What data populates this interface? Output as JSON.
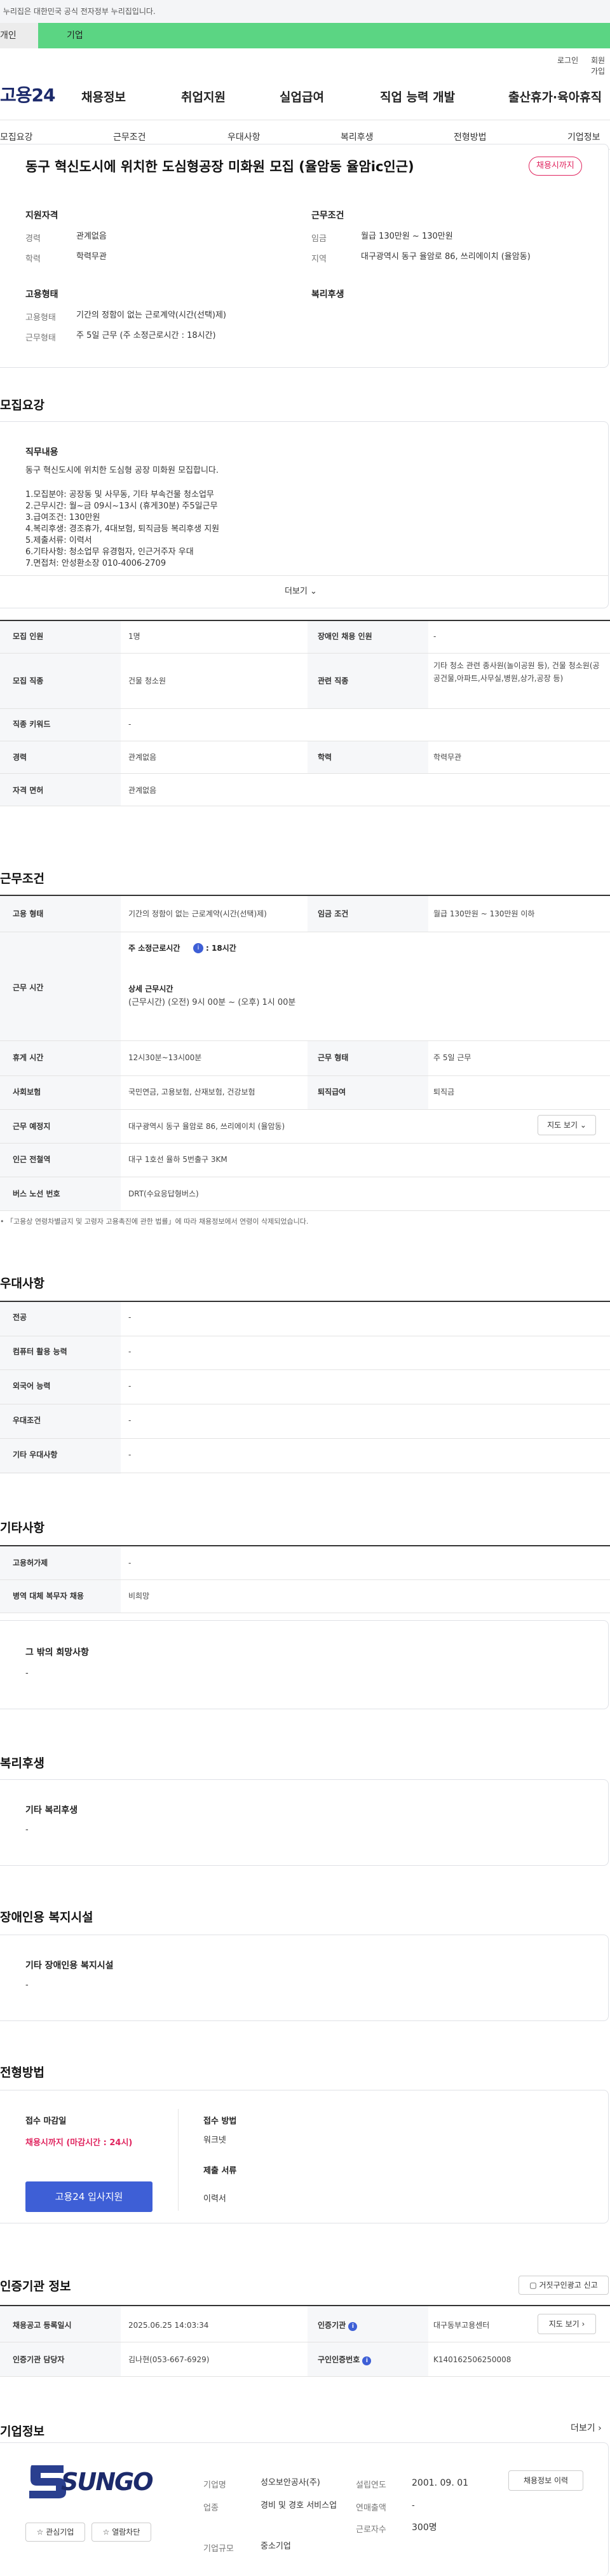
{
  "gov_banner": "이 누리집은 대한민국 공식 전자정부 누리집입니다.",
  "top_tabs": [
    "개인",
    "기업"
  ],
  "util": {
    "login": "로그인",
    "join": "회원가입"
  },
  "logo": "고용24",
  "gnb": [
    "채용정보",
    "취업지원",
    "실업급여",
    "직업 능력 개발",
    "출산휴가·육아휴직"
  ],
  "sub_nav": [
    "모집요강",
    "근무조건",
    "우대사항",
    "복리후생",
    "전형방법",
    "기업정보"
  ],
  "job": {
    "title": "동구 혁신도시에 위치한 도심형공장 미화원 모집 (율암동 율암ic인근)",
    "badge": "채용시까지"
  },
  "summary": {
    "qual_title": "지원자격",
    "career_k": "경력",
    "career_v": "관계없음",
    "edu_k": "학력",
    "edu_v": "학력무관",
    "cond_title": "근무조건",
    "wage_k": "임금",
    "wage_v": "월급 130만원 ~ 130만원",
    "area_k": "지역",
    "area_v": "대구광역시 동구 율암로 86, 쓰리에이치 (율암동)",
    "type_title": "고용형태",
    "emp_k": "고용형태",
    "emp_v": "기간의 정함이 없는 근로계약(시간(선택)제)",
    "work_k": "근무형태",
    "work_v": "주 5일 근무 (주 소정근로시간 : 18시간)",
    "welfare_title": "복리후생"
  },
  "recruit": {
    "title": "모집요강",
    "duty_title": "직무내용",
    "duty_lines": [
      "동구 혁신도시에 위치한 도심형 공장 미화원 모집합니다.",
      "",
      "1.모집분야: 공장동 및 사무동, 기타 부속건물 청소업무",
      "2.근무시간: 월~금 09시~13시 (휴게30분) 주5일근무",
      "3.급여조건: 130만원",
      "4.복리후생: 경조휴가, 4대보험, 퇴직금등 복리후생 지원",
      "5.제출서류: 이력서",
      "6.기타사항: 청소업무 유경험자, 인근거주자 우대",
      "7.면접처: 안성환소장 010-4006-2709"
    ],
    "more": "더보기"
  },
  "recruit_table": {
    "count_k": "모집 인원",
    "count_v": "1명",
    "disabled_k": "장애인 채용 인원",
    "disabled_v": "-",
    "job_k": "모집 직종",
    "job_v": "건물 청소원",
    "rel_k": "관련 직종",
    "rel_v": "기타 청소 관련 종사원(놀이공원 등), 건물 청소원(공공건물,아파트,사무실,병원,상가,공장 등)",
    "kw_k": "직종 키워드",
    "kw_v": "-",
    "career_k": "경력",
    "career_v": "관계없음",
    "edu_k": "학력",
    "edu_v": "학력무관",
    "lic_k": "자격 면허",
    "lic_v": "관계없음"
  },
  "conditions": {
    "title": "근무조건",
    "emp_k": "고용 형태",
    "emp_v": "기간의 정함이 없는 근로계약(시간(선택)제)",
    "wage_k": "임금 조건",
    "wage_v": "월급 130만원 ~ 130만원 이하",
    "hours_k": "근무 시간",
    "week_label": "주 소정근로시간",
    "week_v": ": 18시간",
    "detail_label": "상세 근무시간",
    "detail_v": "(근무시간) (오전) 9시 00분 ~ (오후) 1시 00분",
    "rest_k": "휴게 시간",
    "rest_v": "12시30분~13시00분",
    "wtype_k": "근무 형태",
    "wtype_v": "주 5일 근무",
    "ins_k": "사회보험",
    "ins_v": "국민연금, 고용보험, 산재보험, 건강보험",
    "ret_k": "퇴직급여",
    "ret_v": "퇴직금",
    "place_k": "근무 예정지",
    "place_v": "대구광역시 동구 율암로 86, 쓰리에이치 (율암동)",
    "map": "지도 보기",
    "subway_k": "인근 전철역",
    "subway_v": "대구 1호선 율하 5번출구 3KM",
    "bus_k": "버스 노선 번호",
    "bus_v": "DRT(수요응답형버스)",
    "note": "「고용상 연령차별금지 및 고령자 고용촉진에 관한 법률」에 따라 채용정보에서 연령이 삭제되었습니다."
  },
  "prefer": {
    "title": "우대사항",
    "rows": [
      [
        "전공",
        "-"
      ],
      [
        "컴퓨터 활용 능력",
        "-"
      ],
      [
        "외국어 능력",
        "-"
      ],
      [
        "우대조건",
        "-"
      ],
      [
        "기타 우대사항",
        "-"
      ]
    ]
  },
  "etc": {
    "title": "기타사항",
    "rows": [
      [
        "고용허가제",
        "-"
      ],
      [
        "병역 대체 복무자 채용",
        "비희망"
      ]
    ],
    "hope_title": "그 밖의 희망사항",
    "hope_v": "-"
  },
  "welfare": {
    "title": "복리후생",
    "box_title": "기타 복리후생",
    "box_v": "-"
  },
  "facility": {
    "title": "장애인용 복지시설",
    "box_title": "기타 장애인용 복지시설",
    "box_v": "-"
  },
  "process": {
    "title": "전형방법",
    "deadline_k": "접수 마감일",
    "deadline_v": "채용시까지 (마감시간 : 24시)",
    "apply": "고용24 입사지원",
    "method_k": "접수 방법",
    "method_v": "워크넷",
    "docs_k": "제출 서류",
    "docs_v": "이력서"
  },
  "agency": {
    "title": "인증기관 정보",
    "report": "거짓구인광고 신고",
    "reg_k": "채용공고 등록일시",
    "reg_v": "2025.06.25 14:03:34",
    "org_k": "인증기관",
    "org_v": "대구동부고용센터",
    "map": "지도 보기",
    "mgr_k": "인증기관 담당자",
    "mgr_v": "김나현(053-667-6929)",
    "id_k": "구인인증번호",
    "id_v": "K140162506250008"
  },
  "company": {
    "title": "기업정보",
    "more": "더보기",
    "logo": "SUNGO",
    "interest": "관심기업",
    "block": "열람차단",
    "name_k": "기업명",
    "name_v": "성오보안공사(주)",
    "found_k": "설립연도",
    "found_v": "2001. 09. 01",
    "history": "채용정보 이력",
    "ind_k": "업종",
    "ind_v": "경비 및 경호 서비스업",
    "sales_k": "연매출액",
    "sales_v": "-",
    "size_k": "기업규모",
    "size_v": "중소기업",
    "emp_k": "근로자수",
    "emp_v": "300명"
  },
  "colors": {
    "accent": "#3e5fd6",
    "green": "#5bd583",
    "red": "#e0245e"
  }
}
